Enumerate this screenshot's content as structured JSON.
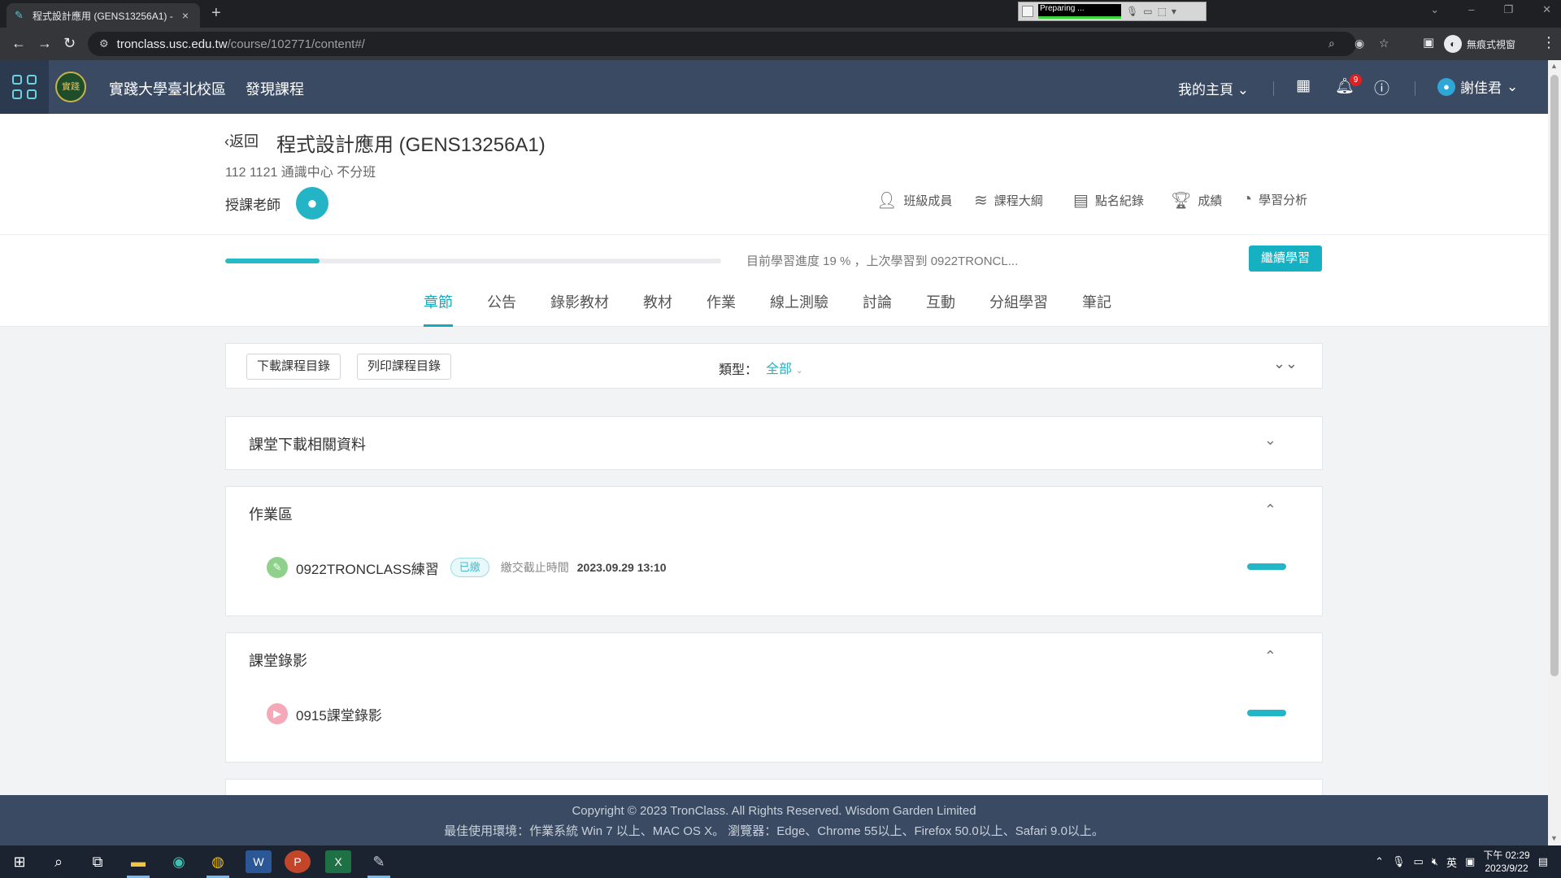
{
  "browser": {
    "tab_title": "程式設計應用 (GENS13256A1) -",
    "tab_close": "×",
    "new_tab": "+",
    "url_host": "tronclass.usc.edu.tw",
    "url_path": "/course/102771/content#/",
    "profile_label": "無痕式視窗",
    "window_controls": [
      "⌄",
      "–",
      "❐",
      "✕"
    ]
  },
  "recorder": {
    "status": "Preparing ..."
  },
  "site": {
    "school_name": "實踐大學臺北校區",
    "discover": "發現課程",
    "my_home": "我的主頁",
    "bell_count": "9",
    "user_name": "謝佳君",
    "logo_text": "實踐"
  },
  "course": {
    "back": "返回",
    "title": "程式設計應用 (GENS13256A1)",
    "meta": "112 1121 通識中心 不分班",
    "teacher_label": "授課老師",
    "actions": [
      {
        "label": "班級成員",
        "icon": "members-icon"
      },
      {
        "label": "課程大綱",
        "icon": "syllabus-icon"
      },
      {
        "label": "點名紀錄",
        "icon": "rollcall-icon"
      },
      {
        "label": "成績",
        "icon": "trophy-icon"
      },
      {
        "label": "學習分析",
        "icon": "analytics-icon"
      }
    ],
    "progress_percent": 19,
    "progress_text": "目前學習進度 19 % ，上次學習到 0922TRONCL...",
    "continue_label": "繼續學習",
    "tabs": [
      "章節",
      "公告",
      "錄影教材",
      "教材",
      "作業",
      "線上測驗",
      "討論",
      "互動",
      "分組學習",
      "筆記"
    ],
    "active_tab": "章節"
  },
  "toolbar": {
    "download_label": "下載課程目錄",
    "print_label": "列印課程目錄",
    "type_label": "類型：",
    "type_value": "全部"
  },
  "sections": [
    {
      "title": "課堂下載相關資料",
      "expanded": false,
      "items": []
    },
    {
      "title": "作業區",
      "expanded": true,
      "items": [
        {
          "name": "0922TRONCLASS練習",
          "badge": "已繳",
          "deadline_label": "繳交截止時間",
          "deadline": "2023.09.29 13:10",
          "icon": "homework-icon",
          "icon_color": "#8fd18a"
        }
      ]
    },
    {
      "title": "課堂錄影",
      "expanded": true,
      "items": [
        {
          "name": "0915課堂錄影",
          "icon": "video-icon",
          "icon_color": "#f5a9b8"
        }
      ]
    }
  ],
  "footer": {
    "copyright": "Copyright © 2023 TronClass. All Rights Reserved. Wisdom Garden Limited",
    "env": "最佳使用環境：作業系統 Win 7 以上、MAC OS X。 瀏覽器：Edge、Chrome 55以上、Firefox 50.0以上、Safari 9.0以上。"
  },
  "taskbar": {
    "tray_lang": "英",
    "time": "下午 02:29",
    "date": "2023/9/22"
  },
  "colors": {
    "accent": "#16a9bc",
    "header_bg": "#3a4a63",
    "progress": "#26b9c8"
  }
}
